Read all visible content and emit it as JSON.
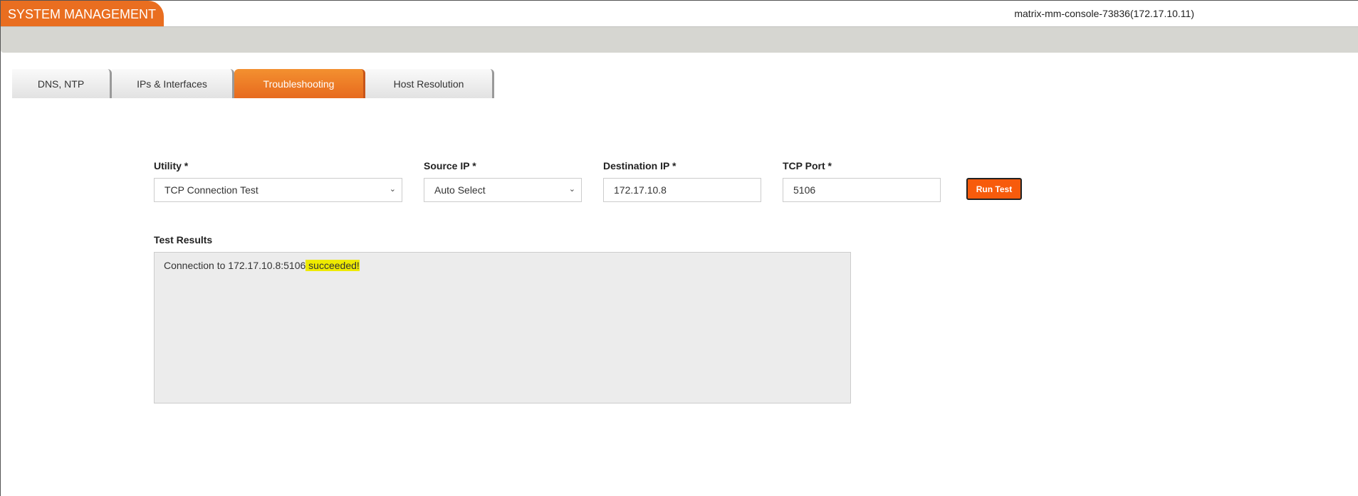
{
  "header": {
    "title": "SYSTEM MANAGEMENT",
    "hostname": "matrix-mm-console-73836(172.17.10.11)"
  },
  "tabs": [
    {
      "label": "DNS, NTP"
    },
    {
      "label": "IPs & Interfaces"
    },
    {
      "label": "Troubleshooting",
      "active": true
    },
    {
      "label": "Host Resolution"
    }
  ],
  "form": {
    "utility": {
      "label": "Utility *",
      "value": "TCP Connection Test"
    },
    "source_ip": {
      "label": "Source IP *",
      "value": "Auto Select"
    },
    "destination_ip": {
      "label": "Destination IP *",
      "value": "172.17.10.8"
    },
    "tcp_port": {
      "label": "TCP Port *",
      "value": "5106"
    },
    "run_label": "Run Test"
  },
  "results": {
    "label": "Test Results",
    "text_prefix": "Connection to 172.17.10.8:5106",
    "text_status": " succeeded!"
  },
  "colors": {
    "accent": "#e96e20",
    "button": "#f75b0c",
    "highlight": "#eeea00"
  }
}
